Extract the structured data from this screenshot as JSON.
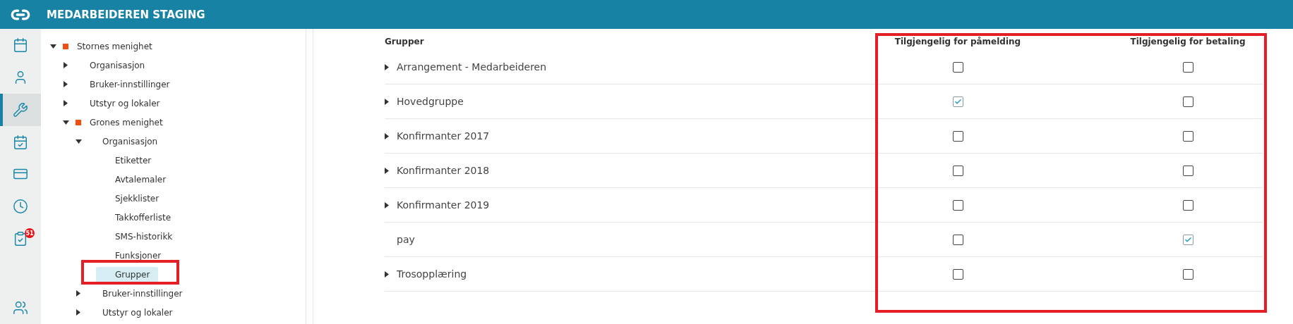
{
  "header": {
    "title": "MEDARBEIDEREN STAGING"
  },
  "rail": [
    {
      "selected": false
    },
    {
      "selected": false
    },
    {
      "selected": true
    },
    {
      "selected": false
    },
    {
      "selected": false
    },
    {
      "selected": false
    },
    {
      "selected": false,
      "badge": "51"
    },
    {
      "selected": false
    }
  ],
  "tree": [
    {
      "label": "Stornes menighet",
      "marked": true,
      "kind": "folder",
      "expanded": true,
      "selected": false,
      "children": [
        {
          "label": "Organisasjon",
          "marked": false,
          "kind": "folder",
          "expanded": false,
          "selected": false
        },
        {
          "label": "Bruker-innstillinger",
          "marked": false,
          "kind": "folder",
          "expanded": false,
          "selected": false
        },
        {
          "label": "Utstyr og lokaler",
          "marked": false,
          "kind": "folder",
          "expanded": false,
          "selected": false
        },
        {
          "label": "Grones menighet",
          "marked": true,
          "kind": "folder",
          "expanded": true,
          "selected": false,
          "children": [
            {
              "label": "Organisasjon",
              "marked": false,
              "kind": "folder",
              "expanded": true,
              "selected": false,
              "children": [
                {
                  "label": "Etiketter",
                  "marked": false,
                  "kind": "leaf",
                  "selected": false
                },
                {
                  "label": "Avtalemaler",
                  "marked": false,
                  "kind": "leaf",
                  "selected": false
                },
                {
                  "label": "Sjekklister",
                  "marked": false,
                  "kind": "leaf",
                  "selected": false
                },
                {
                  "label": "Takkofferliste",
                  "marked": false,
                  "kind": "leaf",
                  "selected": false
                },
                {
                  "label": "SMS-historikk",
                  "marked": false,
                  "kind": "leaf",
                  "selected": false
                },
                {
                  "label": "Funksjoner",
                  "marked": false,
                  "kind": "leaf",
                  "selected": false
                },
                {
                  "label": "Grupper",
                  "marked": false,
                  "kind": "leaf",
                  "selected": true
                }
              ]
            },
            {
              "label": "Bruker-innstillinger",
              "marked": false,
              "kind": "folder",
              "expanded": false,
              "selected": false
            },
            {
              "label": "Utstyr og lokaler",
              "marked": false,
              "kind": "folder",
              "expanded": false,
              "selected": false
            }
          ]
        }
      ]
    }
  ],
  "table": {
    "columns": [
      "Grupper",
      "Tilgjengelig for påmelding",
      "Tilgjengelig for betaling"
    ],
    "rows": [
      {
        "name": "Arrangement - Medarbeideren",
        "expandable": true,
        "signup": false,
        "payment": false
      },
      {
        "name": "Hovedgruppe",
        "expandable": true,
        "signup": true,
        "payment": false
      },
      {
        "name": "Konfirmanter 2017",
        "expandable": true,
        "signup": false,
        "payment": false
      },
      {
        "name": "Konfirmanter 2018",
        "expandable": true,
        "signup": false,
        "payment": false
      },
      {
        "name": "Konfirmanter 2019",
        "expandable": true,
        "signup": false,
        "payment": false
      },
      {
        "name": "pay",
        "expandable": false,
        "signup": false,
        "payment": true
      },
      {
        "name": "Trosopplæring",
        "expandable": true,
        "signup": false,
        "payment": false
      }
    ]
  }
}
